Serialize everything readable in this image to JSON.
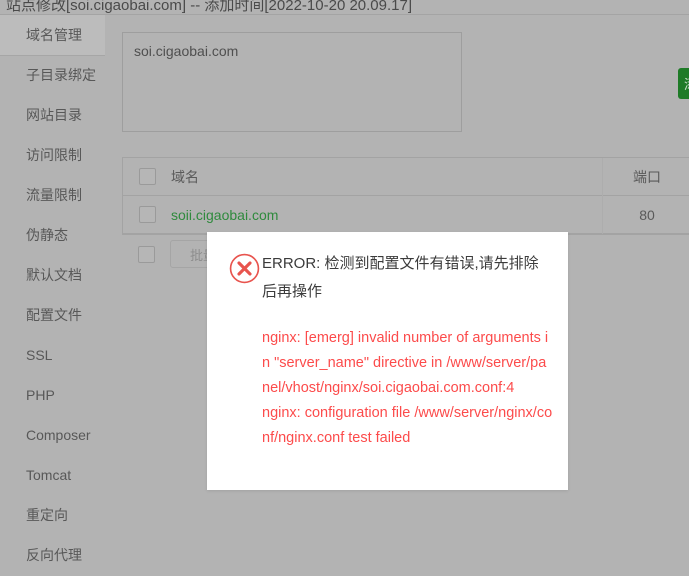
{
  "window": {
    "title": "站点修改[soi.cigaobai.com] -- 添加时间[2022-10-20 20.09.17]"
  },
  "sidebar": {
    "items": [
      {
        "label": "域名管理",
        "active": true
      },
      {
        "label": "子目录绑定",
        "active": false
      },
      {
        "label": "网站目录",
        "active": false
      },
      {
        "label": "访问限制",
        "active": false
      },
      {
        "label": "流量限制",
        "active": false
      },
      {
        "label": "伪静态",
        "active": false
      },
      {
        "label": "默认文档",
        "active": false
      },
      {
        "label": "配置文件",
        "active": false
      },
      {
        "label": "SSL",
        "active": false
      },
      {
        "label": "PHP",
        "active": false
      },
      {
        "label": "Composer",
        "active": false
      },
      {
        "label": "Tomcat",
        "active": false
      },
      {
        "label": "重定向",
        "active": false
      },
      {
        "label": "反向代理",
        "active": false
      }
    ]
  },
  "main": {
    "domain_textarea": {
      "value": "soi.cigaobai.com",
      "placeholder": ""
    },
    "add_button_label": "添加",
    "table": {
      "columns": [
        "域名",
        "端口"
      ],
      "rows": [
        {
          "domain": "soii.cigaobai.com",
          "port": "80"
        }
      ]
    },
    "batch_delete_label": "批量删除"
  },
  "dialog": {
    "icon": "error-circle-x-icon",
    "heading": "ERROR: 检测到配置文件有错误,请先排除后再操作",
    "body_lines": [
      "nginx: [emerg] invalid number of arguments in \"server_name\" directive in /www/server/panel/vhost/nginx/soi.cigaobai.com.conf:4",
      "nginx: configuration file /www/server/nginx/conf/nginx.conf test failed"
    ]
  },
  "colors": {
    "overlay": "#b3b3b3",
    "accent_green": "#1e7b27",
    "link_green": "#2f8a3d",
    "error_red": "#fc4b4b",
    "dialog_bg": "#ffffff"
  }
}
